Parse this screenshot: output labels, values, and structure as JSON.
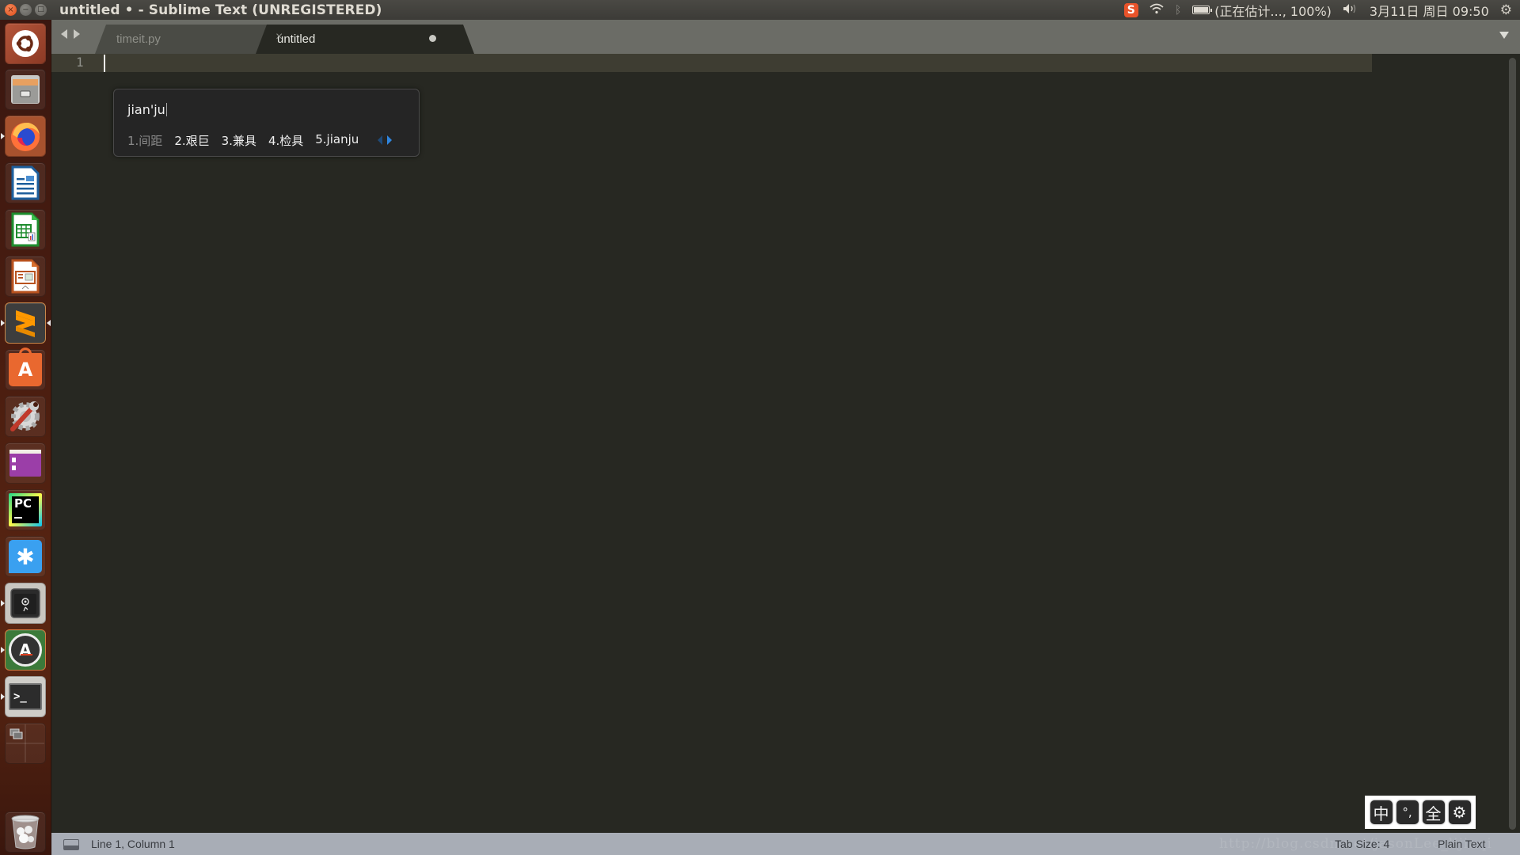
{
  "window": {
    "title": "untitled • - Sublime Text (UNREGISTERED)",
    "controls": {
      "close": "×",
      "minimize": "−",
      "maximize": "□"
    }
  },
  "indicators": {
    "input_method": "S",
    "wifi": "wifi-icon",
    "bluetooth": "bluetooth-icon",
    "battery_text": "(正在估计..., 100%)",
    "volume": "volume-icon",
    "datetime": "3月11日 周日 09:50",
    "session": "gear-icon"
  },
  "launcher": {
    "items": [
      {
        "name": "dash-home",
        "icon": "ubuntu-logo-icon"
      },
      {
        "name": "files",
        "icon": "file-cabinet-icon"
      },
      {
        "name": "firefox",
        "icon": "firefox-icon"
      },
      {
        "name": "libreoffice-writer",
        "icon": "writer-icon"
      },
      {
        "name": "libreoffice-calc",
        "icon": "calc-icon"
      },
      {
        "name": "libreoffice-impress",
        "icon": "impress-icon"
      },
      {
        "name": "sublime-text",
        "icon": "sublime-text-icon",
        "glyph": "S"
      },
      {
        "name": "ubuntu-software",
        "icon": "shopping-bag-icon",
        "glyph": "A"
      },
      {
        "name": "system-settings",
        "icon": "wrench-gear-icon"
      },
      {
        "name": "purple-app",
        "icon": "window-icon"
      },
      {
        "name": "pycharm",
        "icon": "pycharm-icon",
        "glyph": "PC"
      },
      {
        "name": "chat-app",
        "icon": "asterisk-chat-icon",
        "glyph": "✱"
      },
      {
        "name": "vault",
        "icon": "safe-icon"
      },
      {
        "name": "software-updater",
        "icon": "updater-icon",
        "glyph": "A"
      },
      {
        "name": "terminal",
        "icon": "terminal-icon",
        "glyph": ">_"
      },
      {
        "name": "workspaces",
        "icon": "workspace-switcher-icon"
      },
      {
        "name": "trash",
        "icon": "trash-icon"
      }
    ]
  },
  "tabs": [
    {
      "label": "timeit.py",
      "active": false,
      "close": "×"
    },
    {
      "label": "untitled",
      "active": true,
      "dirty": true
    }
  ],
  "editor": {
    "line_numbers": [
      "1"
    ],
    "content": ""
  },
  "ime": {
    "input": "jian'ju",
    "candidates": [
      "1.间距",
      "2.艰巨",
      "3.兼具",
      "4.检具",
      "5.jianju"
    ],
    "toolbar": [
      "中",
      "°,",
      "全",
      "⚙"
    ]
  },
  "status": {
    "position": "Line 1, Column 1",
    "tab_size": "Tab Size: 4",
    "syntax": "Plain Text",
    "watermark": "http://blog.csdn.net/jasonLee_lijiaqi"
  }
}
